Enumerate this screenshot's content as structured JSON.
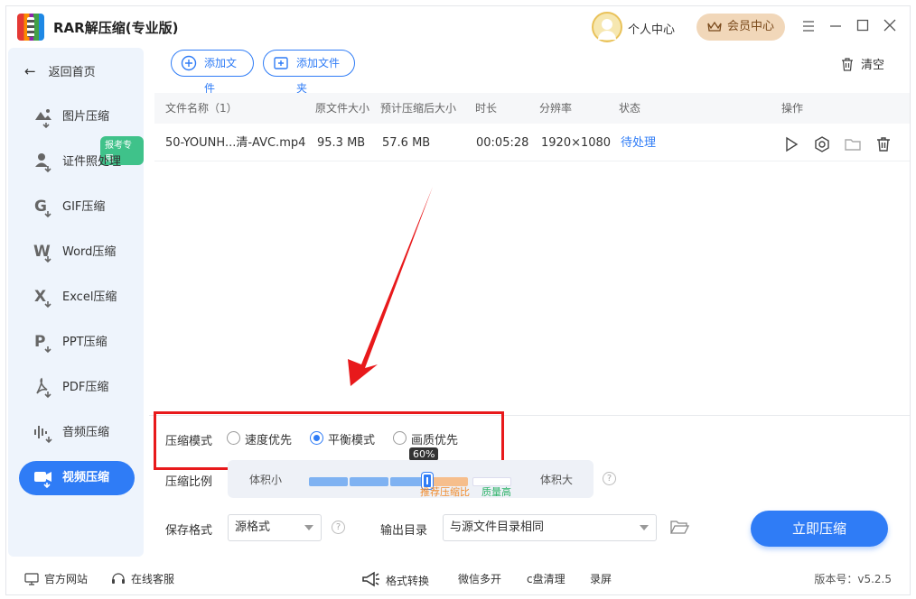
{
  "app": {
    "title": "RAR解压缩(专业版)"
  },
  "header": {
    "user_center": "个人中心",
    "vip_center": "会员中心"
  },
  "sidebar": {
    "back": "返回首页",
    "badge": "报考专用",
    "items": [
      {
        "label": "图片压缩",
        "icon": "image-icon"
      },
      {
        "label": "证件照处理",
        "icon": "id-photo-icon"
      },
      {
        "label": "GIF压缩",
        "icon": "gif-icon"
      },
      {
        "label": "Word压缩",
        "icon": "word-icon"
      },
      {
        "label": "Excel压缩",
        "icon": "excel-icon"
      },
      {
        "label": "PPT压缩",
        "icon": "ppt-icon"
      },
      {
        "label": "PDF压缩",
        "icon": "pdf-icon"
      },
      {
        "label": "音频压缩",
        "icon": "audio-icon"
      },
      {
        "label": "视频压缩",
        "icon": "video-icon",
        "active": true
      }
    ]
  },
  "toolbar": {
    "add_file": "添加文件",
    "add_folder": "添加文件夹",
    "clear": "清空"
  },
  "table": {
    "headers": [
      "文件名称（1）",
      "原文件大小",
      "预计压缩后大小",
      "时长",
      "分辨率",
      "状态",
      "操作"
    ],
    "rows": [
      {
        "name": "50-YOUNH...清-AVC.mp4",
        "orig_size": "95.3 MB",
        "est_size": "57.6 MB",
        "duration": "00:05:28",
        "resolution": "1920×1080",
        "status": "待处理"
      }
    ]
  },
  "settings": {
    "mode_label": "压缩模式",
    "modes": [
      "速度优先",
      "平衡模式",
      "画质优先"
    ],
    "selected_mode": "平衡模式",
    "ratio_label": "压缩比例",
    "ratio_min": "体积小",
    "ratio_max": "体积大",
    "ratio_value": "60%",
    "ratio_fraction": 0.6,
    "recommended": "推荐压缩比",
    "quality_high": "质量高",
    "save_format_label": "保存格式",
    "save_format_value": "源格式",
    "output_dir_label": "输出目录",
    "output_dir_value": "与源文件目录相同",
    "compress_button": "立即压缩"
  },
  "footer": {
    "website": "官方网站",
    "service": "在线客服",
    "links": [
      "格式转换",
      "微信多开",
      "c盘清理",
      "录屏"
    ],
    "version": "版本号：v5.2.5"
  },
  "colors": {
    "accent": "#2f7cf6",
    "highlight_box": "#e8191b",
    "vip_bg": "#f1d7b9"
  }
}
